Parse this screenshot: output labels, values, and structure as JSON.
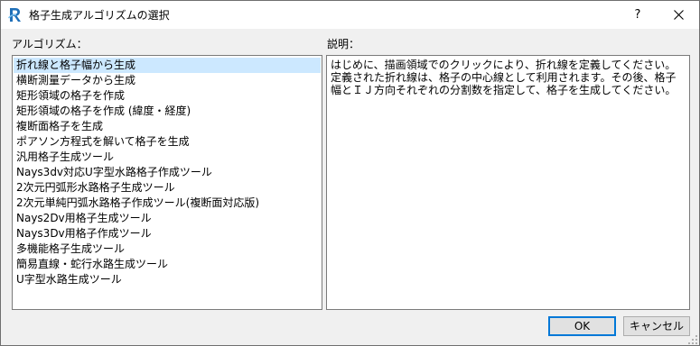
{
  "window": {
    "title": "格子生成アルゴリズムの選択",
    "help_label": "?",
    "accent_color": "#0078d7"
  },
  "algorithm": {
    "label": "アルゴリズム：",
    "selected_index": 0,
    "items": [
      "折れ線と格子幅から生成",
      "横断測量データから生成",
      "矩形領域の格子を作成",
      "矩形領域の格子を作成 (緯度・経度)",
      "複断面格子を生成",
      "ポアソン方程式を解いて格子を生成",
      "汎用格子生成ツール",
      "Nays3dv対応U字型水路格子作成ツール",
      "2次元円弧形水路格子生成ツール",
      "2次元単純円弧水路格子作成ツール(複断面対応版)",
      "Nays2Dv用格子生成ツール",
      "Nays3Dv用格子作成ツール",
      "多機能格子生成ツール",
      "簡易直線・蛇行水路生成ツール",
      "U字型水路生成ツール"
    ]
  },
  "description": {
    "label": "説明：",
    "text": "はじめに、描画領域でのクリックにより、折れ線を定義してください。定義された折れ線は、格子の中心線として利用されます。その後、格子幅とＩＪ方向それぞれの分割数を指定して、格子を生成してください。"
  },
  "buttons": {
    "ok": "OK",
    "cancel": "キャンセル"
  }
}
